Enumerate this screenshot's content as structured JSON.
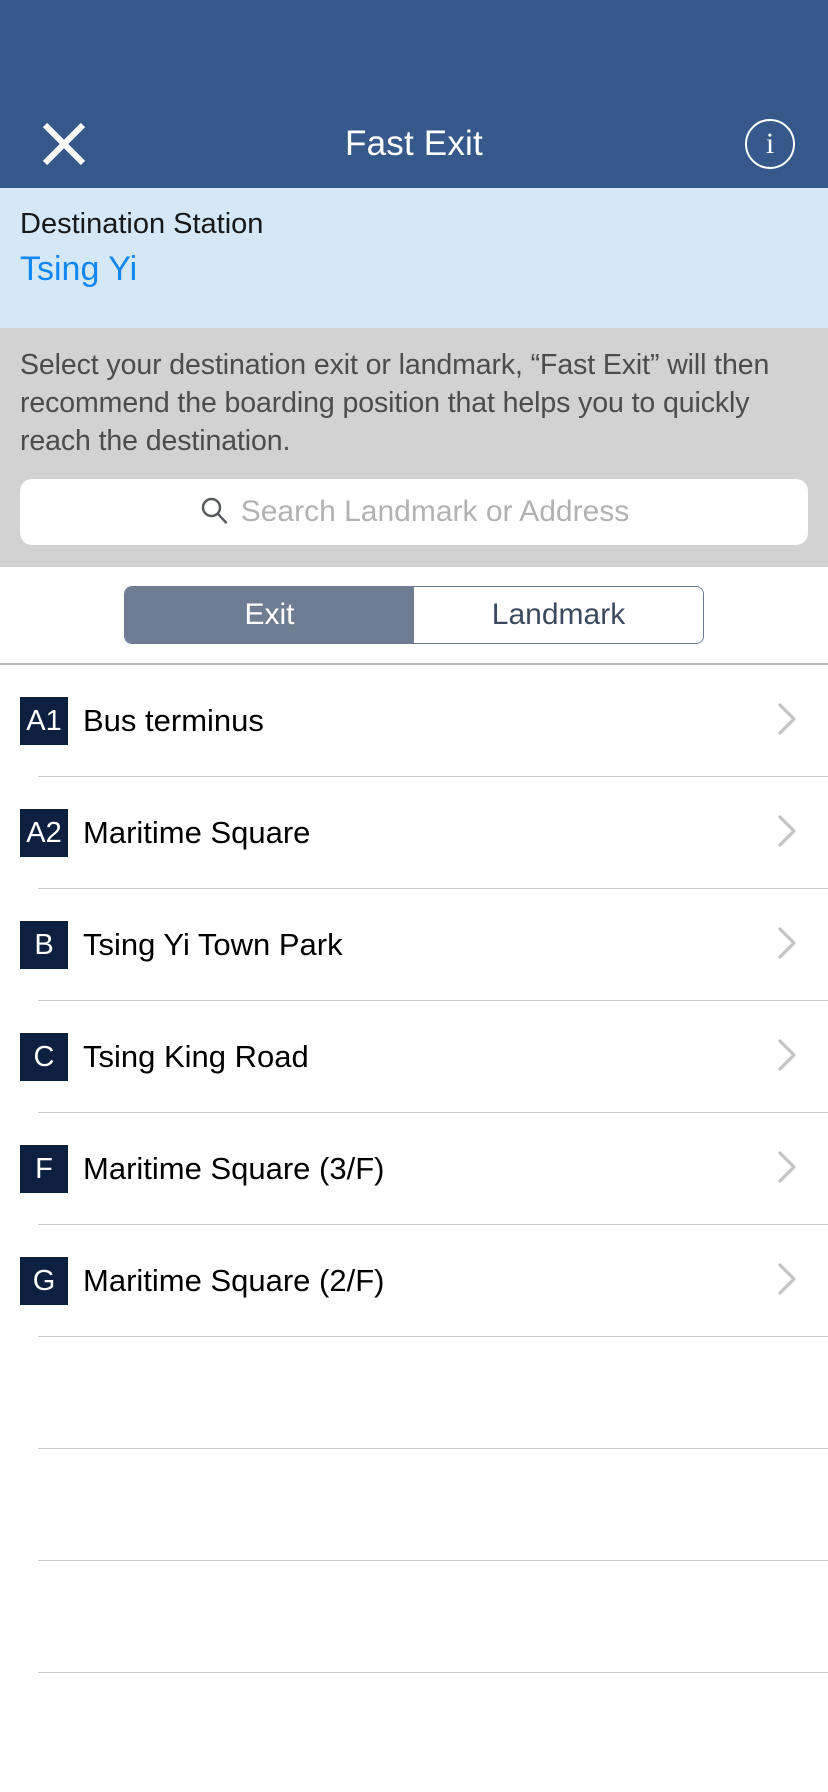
{
  "header": {
    "title": "Fast Exit",
    "close_icon": "close-x-icon",
    "info_icon": "info-circle-icon",
    "background_color": "#36588a"
  },
  "destination": {
    "label": "Destination Station",
    "station": "Tsing Yi",
    "background_color": "#d4e8f7",
    "station_color": "#1287f5"
  },
  "panel": {
    "instruction": "Select your destination exit or landmark, “Fast Exit” will then recommend the boarding position that helps you to quickly reach the destination.",
    "background_color": "#d2d2d2"
  },
  "search": {
    "placeholder": "Search Landmark or Address",
    "value": "",
    "icon": "search-icon"
  },
  "segmented_control": {
    "selected": "Exit",
    "options": [
      {
        "label": "Exit",
        "selected": true
      },
      {
        "label": "Landmark",
        "selected": false
      }
    ],
    "active_color": "#6f7d93"
  },
  "exit_list": {
    "badge_color": "#0d2040",
    "chevron_icon": "chevron-right-icon",
    "rows": [
      {
        "badge": "A1",
        "label": "Bus terminus"
      },
      {
        "badge": "A2",
        "label": "Maritime Square"
      },
      {
        "badge": "B",
        "label": "Tsing Yi Town Park"
      },
      {
        "badge": "C",
        "label": "Tsing King Road"
      },
      {
        "badge": "F",
        "label": "Maritime Square (3/F)"
      },
      {
        "badge": "G",
        "label": "Maritime Square (2/F)"
      }
    ]
  }
}
